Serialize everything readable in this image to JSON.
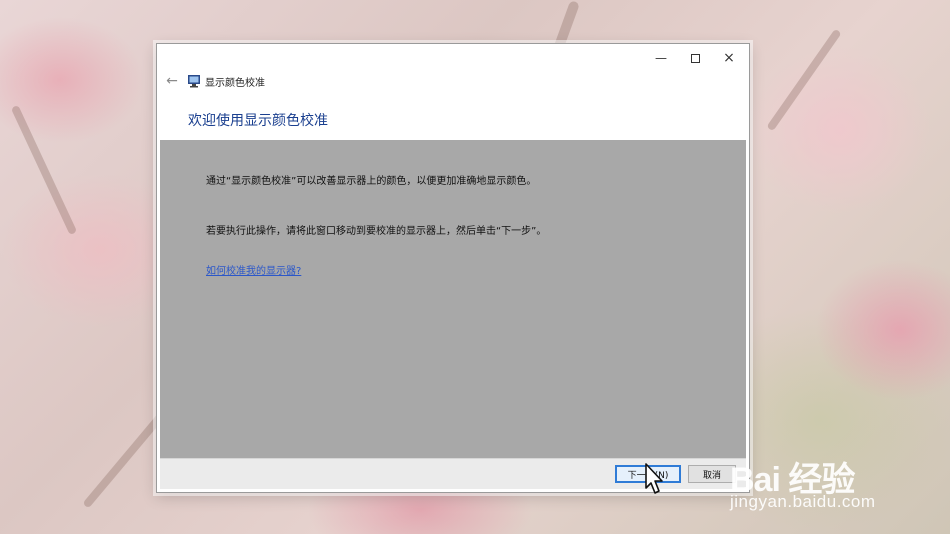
{
  "window": {
    "title": "显示颜色校准",
    "controls": [
      "minimize",
      "maximize",
      "close"
    ]
  },
  "wizard": {
    "heading": "欢迎使用显示颜色校准",
    "paragraph_1": "通过“显示颜色校准”可以改善显示器上的颜色，以便更加准确地显示颜色。",
    "paragraph_2": "若要执行此操作，请将此窗口移动到要校准的显示器上，然后单击“下一步”。",
    "help_link": "如何校准我的显示器?"
  },
  "footer": {
    "next_label": "下一步(N)",
    "cancel_label": "取消"
  },
  "watermark": {
    "logo": "Bai 经验",
    "site": "jingyan.baidu.com"
  },
  "colors": {
    "heading": "#1a3f8f",
    "link": "#2b57c9",
    "content_bg": "#a8a8a8",
    "primary_border": "#2f7bd6"
  }
}
